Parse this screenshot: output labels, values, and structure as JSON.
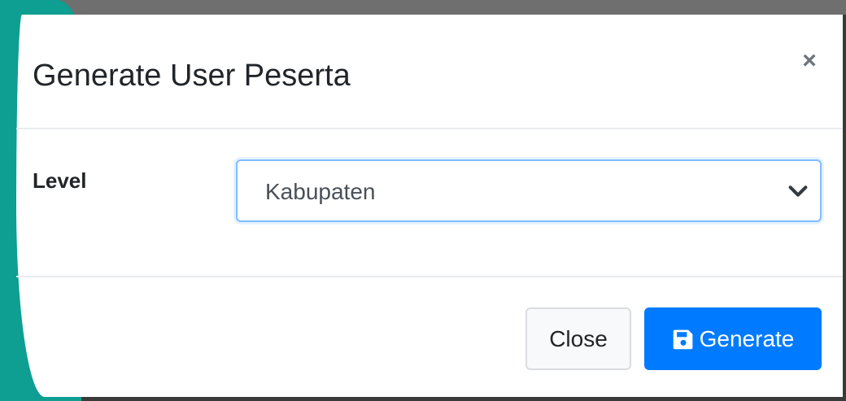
{
  "modal": {
    "title": "Generate User Peserta",
    "close_symbol": "×"
  },
  "form": {
    "level_label": "Level",
    "level_selected": "Kabupaten"
  },
  "footer": {
    "close_label": "Close",
    "generate_label": "Generate"
  },
  "colors": {
    "primary": "#007bff",
    "teal_background": "#0e9e92",
    "focus_border": "#80bdff"
  },
  "icons": {
    "close": "close-icon",
    "dropdown": "chevron-down-icon",
    "generate": "save-icon"
  }
}
